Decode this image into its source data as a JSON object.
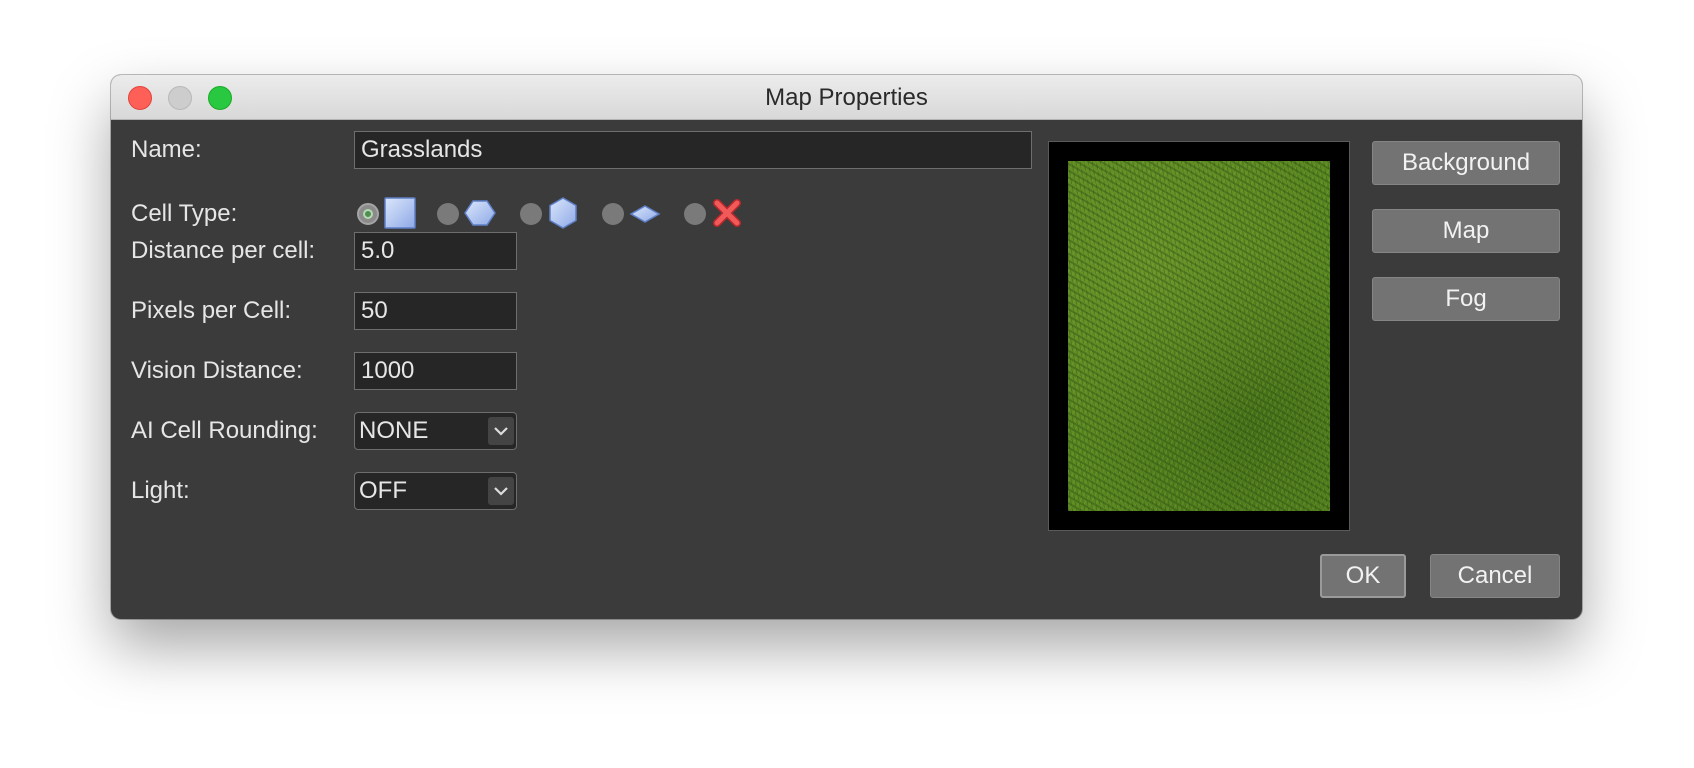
{
  "window": {
    "title": "Map Properties"
  },
  "form": {
    "name_label": "Name:",
    "name_value": "Grasslands",
    "cell_type_label": "Cell Type:",
    "cell_type_options": [
      {
        "icon": "square-grid-icon",
        "selected": true
      },
      {
        "icon": "hex-horizontal-icon",
        "selected": false
      },
      {
        "icon": "hex-vertical-icon",
        "selected": false
      },
      {
        "icon": "isometric-icon",
        "selected": false
      },
      {
        "icon": "no-grid-icon",
        "selected": false
      }
    ],
    "distance_label": "Distance per cell:",
    "distance_value": "5.0",
    "pixels_label": "Pixels per Cell:",
    "pixels_value": "50",
    "vision_label": "Vision Distance:",
    "vision_value": "1000",
    "ai_rounding_label": "AI Cell Rounding:",
    "ai_rounding_value": "NONE",
    "light_label": "Light:",
    "light_value": "OFF"
  },
  "side_buttons": {
    "background": "Background",
    "map": "Map",
    "fog": "Fog"
  },
  "footer": {
    "ok": "OK",
    "cancel": "Cancel"
  },
  "colors": {
    "window_bg": "#3b3b3b",
    "field_bg": "#262626",
    "button_bg": "#737373",
    "grass": "#5c8a22"
  }
}
